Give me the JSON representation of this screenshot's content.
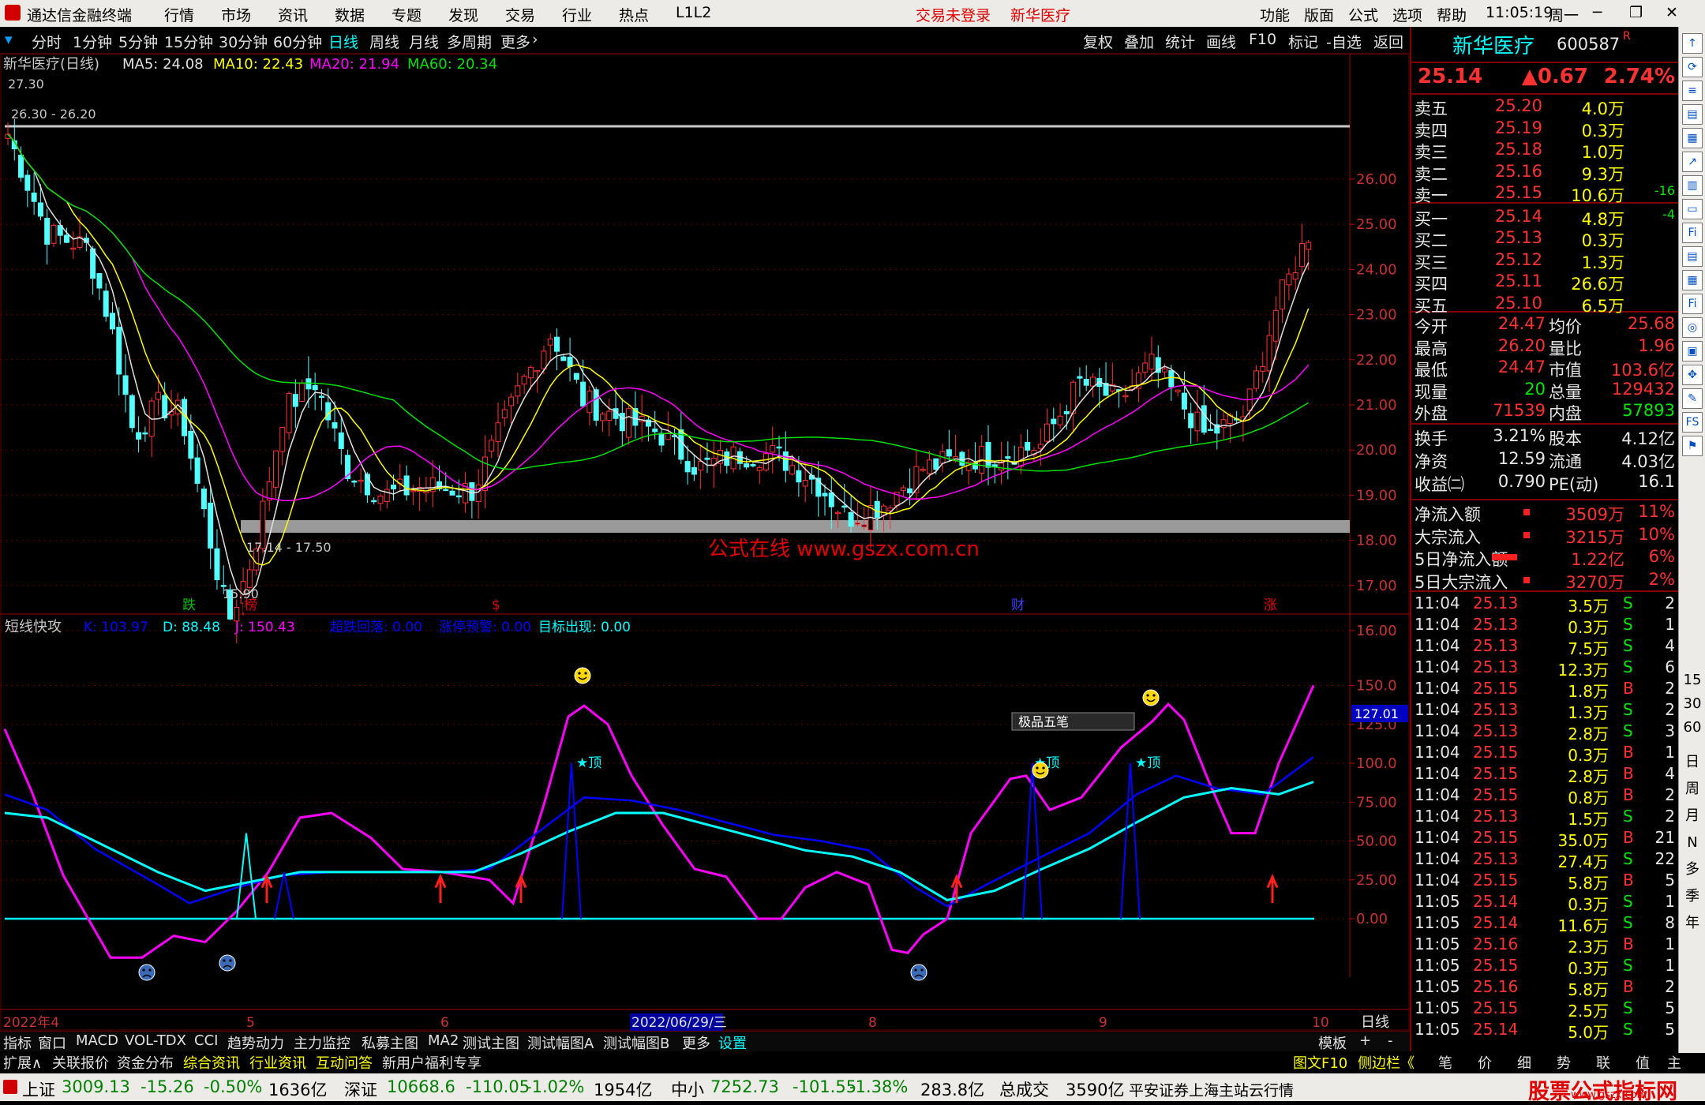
{
  "app": {
    "title": "通达信金融终端",
    "top_menu": [
      "行情",
      "市场",
      "资讯",
      "数据",
      "专题",
      "发现",
      "交易",
      "行业",
      "热点",
      "L1L2"
    ],
    "notice": "交易未登录",
    "stock_title": "新华医疗",
    "right_menu": [
      "功能",
      "版面",
      "公式",
      "选项",
      "帮助"
    ],
    "time": "11:05:19",
    "weekday": "周一"
  },
  "periods": {
    "items": [
      "分时",
      "1分钟",
      "5分钟",
      "15分钟",
      "30分钟",
      "60分钟",
      "日线",
      "周线",
      "月线",
      "多周期",
      "更多"
    ],
    "active": "日线",
    "tools": [
      "复权",
      "叠加",
      "统计",
      "画线",
      "F10",
      "标记",
      "-自选",
      "返回"
    ]
  },
  "main_chart": {
    "title": "新华医疗(日线)",
    "ma": [
      {
        "label": "MA5: 24.08",
        "color": "#e0e0e0"
      },
      {
        "label": "MA10: 22.43",
        "color": "#ffff00"
      },
      {
        "label": "MA20: 21.94",
        "color": "#ff00ff"
      },
      {
        "label": "MA60: 20.34",
        "color": "#00e000"
      }
    ],
    "y_ticks": [
      "26.00",
      "25.00",
      "24.00",
      "23.00",
      "22.00",
      "21.00",
      "20.00",
      "19.00",
      "18.00",
      "17.00",
      "16.00"
    ],
    "annotations": {
      "high": "27.30",
      "upper_band": "26.30 - 26.20",
      "lower_band": "17.14 - 17.50",
      "low": "15.90"
    },
    "watermark": "公式在线  www.gszx.com.cn",
    "events": [
      "跌",
      "榜",
      "$",
      "财",
      "涨"
    ]
  },
  "indicator": {
    "title": "短线快攻",
    "labels": [
      {
        "t": "K: 103.97",
        "c": "#0000ff"
      },
      {
        "t": "D: 88.48",
        "c": "#00ffff"
      },
      {
        "t": "J: 150.43",
        "c": "#ff00ff"
      },
      {
        "t": "超跌回落: 0.00",
        "c": "#0000ff"
      },
      {
        "t": "涨停预警: 0.00",
        "c": "#0000ff"
      },
      {
        "t": "目标出现: 0.00",
        "c": "#00ffff"
      }
    ],
    "y_ticks": [
      "150.0",
      "125.0",
      "100.0",
      "75.00",
      "50.00",
      "25.00",
      "0.00"
    ],
    "cursor_value": "127.01",
    "top_mark": "顶",
    "popup": "极品五笔"
  },
  "x_axis": {
    "labels": [
      "2022年4",
      "5",
      "6",
      "8",
      "9",
      "10"
    ],
    "cursor_date": "2022/06/29/三",
    "period": "日线"
  },
  "tabs_row1": [
    "指标",
    "窗口",
    "MACD",
    "VOL-TDX",
    "CCI",
    "趋势动力",
    "主力监控",
    "私募主图",
    "MA2",
    "测试主图",
    "测试幅图A",
    "测试幅图B",
    "更多",
    "设置"
  ],
  "tabs_row1_right": [
    "模板",
    "+",
    "-"
  ],
  "tabs_row2": [
    "扩展∧",
    "关联报价",
    "资金分布",
    "综合资讯",
    "行业资讯",
    "互动问答",
    "新用户福利专享"
  ],
  "tabs_row2_right": [
    "图文F10",
    "侧边栏《",
    "笔",
    "价",
    "细",
    "势",
    "联",
    "值",
    "主"
  ],
  "quote": {
    "name": "新华医疗",
    "code": "600587",
    "price": "25.14",
    "change": "▲0.67",
    "pct": "2.74%",
    "asks": [
      [
        "卖五",
        "25.20",
        "4.0万",
        ""
      ],
      [
        "卖四",
        "25.19",
        "0.3万",
        ""
      ],
      [
        "卖三",
        "25.18",
        "1.0万",
        ""
      ],
      [
        "卖二",
        "25.16",
        "9.3万",
        ""
      ],
      [
        "卖一",
        "25.15",
        "10.6万",
        "-16"
      ]
    ],
    "bids": [
      [
        "买一",
        "25.14",
        "4.8万",
        "-4"
      ],
      [
        "买二",
        "25.13",
        "0.3万",
        ""
      ],
      [
        "买三",
        "25.12",
        "1.3万",
        ""
      ],
      [
        "买四",
        "25.11",
        "26.6万",
        ""
      ],
      [
        "买五",
        "25.10",
        "6.5万",
        ""
      ]
    ],
    "stats": [
      [
        "今开",
        "24.47",
        "均价",
        "25.68"
      ],
      [
        "最高",
        "26.20",
        "量比",
        "1.96"
      ],
      [
        "最低",
        "24.47",
        "市值",
        "103.6亿"
      ],
      [
        "现量",
        "20",
        "总量",
        "129432"
      ],
      [
        "外盘",
        "71539",
        "内盘",
        "57893"
      ]
    ],
    "stats2": [
      [
        "换手",
        "3.21%",
        "股本",
        "4.12亿"
      ],
      [
        "净资",
        "12.59",
        "流通",
        "4.03亿"
      ],
      [
        "收益㈡",
        "0.790",
        "PE(动)",
        "16.1"
      ]
    ],
    "flows": [
      [
        "净流入额",
        "3509万",
        "11%"
      ],
      [
        "大宗流入",
        "3215万",
        "10%"
      ],
      [
        "5日净流入额",
        "1.22亿",
        "6%"
      ],
      [
        "5日大宗流入",
        "3270万",
        "2%"
      ]
    ],
    "ticks": [
      [
        "11:04",
        "25.13",
        "3.5万",
        "S",
        "2"
      ],
      [
        "11:04",
        "25.13",
        "0.3万",
        "S",
        "1"
      ],
      [
        "11:04",
        "25.13",
        "7.5万",
        "S",
        "4"
      ],
      [
        "11:04",
        "25.13",
        "12.3万",
        "S",
        "6"
      ],
      [
        "11:04",
        "25.15",
        "1.8万",
        "B",
        "2"
      ],
      [
        "11:04",
        "25.13",
        "1.3万",
        "S",
        "2"
      ],
      [
        "11:04",
        "25.13",
        "2.8万",
        "S",
        "3"
      ],
      [
        "11:04",
        "25.15",
        "0.3万",
        "B",
        "1"
      ],
      [
        "11:04",
        "25.15",
        "2.8万",
        "B",
        "4"
      ],
      [
        "11:04",
        "25.15",
        "0.8万",
        "B",
        "2"
      ],
      [
        "11:04",
        "25.13",
        "1.5万",
        "S",
        "2"
      ],
      [
        "11:04",
        "25.15",
        "35.0万",
        "B",
        "21"
      ],
      [
        "11:04",
        "25.13",
        "27.4万",
        "S",
        "22"
      ],
      [
        "11:04",
        "25.15",
        "5.8万",
        "B",
        "5"
      ],
      [
        "11:05",
        "25.14",
        "0.3万",
        "S",
        "1"
      ],
      [
        "11:05",
        "25.14",
        "11.6万",
        "S",
        "8"
      ],
      [
        "11:05",
        "25.16",
        "2.3万",
        "B",
        "1"
      ],
      [
        "11:05",
        "25.15",
        "0.3万",
        "S",
        "1"
      ],
      [
        "11:05",
        "25.16",
        "5.8万",
        "B",
        "2"
      ],
      [
        "11:05",
        "25.15",
        "2.5万",
        "S",
        "5"
      ],
      [
        "11:05",
        "25.14",
        "5.0万",
        "S",
        "5"
      ]
    ]
  },
  "sidebar_text": [
    "日",
    "周",
    "月",
    "N",
    "多",
    "季",
    "年"
  ],
  "sidebar_nums": [
    "15",
    "30",
    "60"
  ],
  "status": {
    "indices": [
      {
        "name": "上证",
        "val": "3009.13",
        "chg": "-15.26",
        "pct": "-0.50%",
        "amt": "1636亿"
      },
      {
        "name": "深证",
        "val": "10668.6",
        "chg": "-110.05",
        "pct": "-1.02%",
        "amt": "1954亿"
      },
      {
        "name": "中小",
        "val": "7252.73",
        "chg": "-101.55",
        "pct": "-1.38%",
        "amt": "283.8亿"
      }
    ],
    "total_label": "总成交",
    "total": "3590亿",
    "broker": "平安证券上海主站云行情",
    "logo": "股票公式指标网",
    "logo_url": "www.gszx.com"
  }
}
